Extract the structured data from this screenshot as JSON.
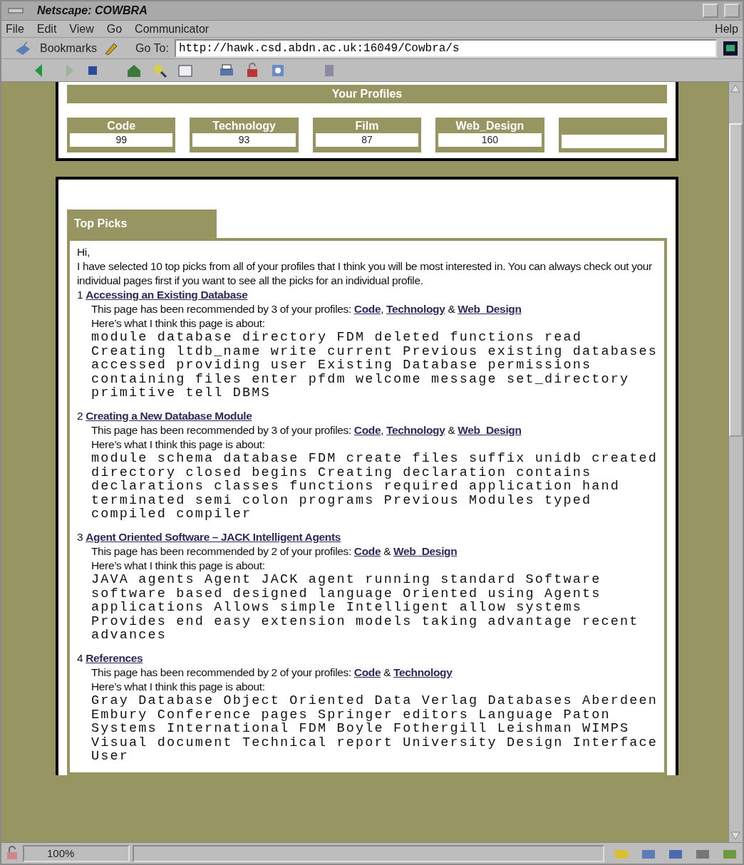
{
  "window": {
    "title": "Netscape: COWBRA"
  },
  "menus": [
    {
      "label": "File"
    },
    {
      "label": "Edit"
    },
    {
      "label": "View"
    },
    {
      "label": "Go"
    },
    {
      "label": "Communicator"
    }
  ],
  "help_menu": "Help",
  "location_bar": {
    "bookmarks": "Bookmarks",
    "goto_label": "Go To:",
    "url": "http://hawk.csd.abdn.ac.uk:16049/Cowbra/s"
  },
  "profiles": {
    "title": "Your Profiles",
    "items": [
      {
        "kind": "profile",
        "name": "Code",
        "score": "99"
      },
      {
        "kind": "profile",
        "name": "Technology",
        "score": "93"
      },
      {
        "kind": "profile",
        "name": "Film",
        "score": "87"
      },
      {
        "kind": "profile",
        "name": "Web_Design",
        "score": "160"
      },
      {
        "kind": "blank"
      }
    ]
  },
  "top_picks": {
    "tab": "Top Picks",
    "greeting": "Hi,",
    "intro": "I have selected 10 top picks from all of your profiles that I think you will be most interested in. You can always check out your individual pages first if you want to see all the picks for an individual profile.",
    "picks": [
      {
        "number": "1",
        "title": "Accessing an Existing Database",
        "recommendation": [
          {
            "kind": "text",
            "text": "This page has been recommended by 3 of your profiles: "
          },
          {
            "kind": "link",
            "text": "Code"
          },
          {
            "kind": "text",
            "text": ", "
          },
          {
            "kind": "link",
            "text": "Technology"
          },
          {
            "kind": "text",
            "text": " & "
          },
          {
            "kind": "link",
            "text": "Web_Design"
          }
        ],
        "about_label": "Here’s what I think this page is about:",
        "keywords": "module database directory FDM deleted functions read\nCreating ltdb_name write current Previous existing databases\naccessed providing user Existing Database permissions\ncontaining files enter pfdm welcome message set_directory\nprimitive tell DBMS"
      },
      {
        "number": "2",
        "title": "Creating a New Database Module",
        "recommendation": [
          {
            "kind": "text",
            "text": "This page has been recommended by 3 of your profiles: "
          },
          {
            "kind": "link",
            "text": "Code"
          },
          {
            "kind": "text",
            "text": ", "
          },
          {
            "kind": "link",
            "text": "Technology"
          },
          {
            "kind": "text",
            "text": " & "
          },
          {
            "kind": "link",
            "text": "Web_Design"
          }
        ],
        "about_label": "Here’s what I think this page is about:",
        "keywords": "module schema database FDM create files suffix unidb created\ndirectory closed begins Creating declaration contains\ndeclarations classes functions required application hand\nterminated semi colon programs Previous Modules typed\ncompiled compiler"
      },
      {
        "number": "3",
        "title": "Agent Oriented Software – JACK Intelligent Agents",
        "recommendation": [
          {
            "kind": "text",
            "text": "This page has been recommended by 2 of your profiles: "
          },
          {
            "kind": "link",
            "text": "Code"
          },
          {
            "kind": "text",
            "text": " & "
          },
          {
            "kind": "link",
            "text": "Web_Design"
          }
        ],
        "about_label": "Here’s what I think this page is about:",
        "keywords": "JAVA agents Agent JACK agent running standard Software\nsoftware based designed language Oriented using Agents\napplications Allows simple Intelligent allow systems\nProvides end easy extension models taking advantage recent\nadvances"
      },
      {
        "number": "4",
        "title": "References",
        "recommendation": [
          {
            "kind": "text",
            "text": "This page has been recommended by 2 of your profiles: "
          },
          {
            "kind": "link",
            "text": "Code"
          },
          {
            "kind": "text",
            "text": " & "
          },
          {
            "kind": "link",
            "text": "Technology"
          }
        ],
        "about_label": "Here’s what I think this page is about:",
        "keywords": "Gray Database Object Oriented Data Verlag Databases Aberdeen\nEmbury Conference pages Springer editors Language Paton\nSystems International FDM Boyle Fothergill Leishman WIMPS\nVisual document Technical report University Design Interface\nUser"
      }
    ]
  },
  "status_bar": {
    "zoom": "100%"
  }
}
